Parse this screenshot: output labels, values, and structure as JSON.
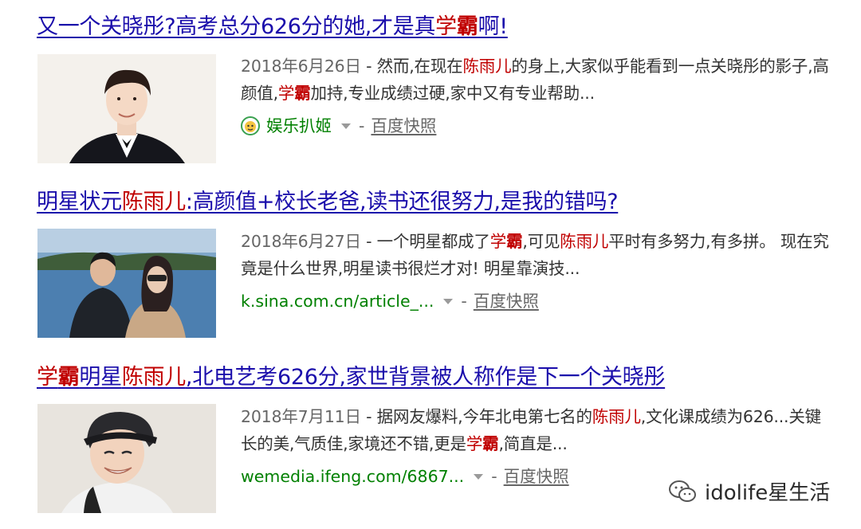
{
  "results": [
    {
      "title_parts": [
        {
          "text": "又一个关晓彤?高考总分626分的她,才是真",
          "style": "normal"
        },
        {
          "text": "学",
          "style": "hl"
        },
        {
          "text": "霸",
          "style": "hl-strong"
        },
        {
          "text": "啊!",
          "style": "normal"
        }
      ],
      "date": "2018年6月26日",
      "abstract_parts": [
        {
          "text": " - 然而,在现在",
          "style": "normal"
        },
        {
          "text": "陈雨儿",
          "style": "hl"
        },
        {
          "text": "的身上,大家似乎能看到一点关晓彤的影子,高颜值,",
          "style": "normal"
        },
        {
          "text": "学",
          "style": "hl"
        },
        {
          "text": "霸",
          "style": "hl-strong"
        },
        {
          "text": "加持,专业成绩过硬,家中又有专业帮助...",
          "style": "normal"
        }
      ],
      "source": "娱乐扒姬",
      "separator": "-",
      "snapshot": "百度快照"
    },
    {
      "title_parts": [
        {
          "text": "明星状元",
          "style": "normal"
        },
        {
          "text": "陈雨儿",
          "style": "hl"
        },
        {
          "text": ":高颜值+校长老爸,读书还很努力,是我的错吗?",
          "style": "normal"
        }
      ],
      "date": "2018年6月27日",
      "abstract_parts": [
        {
          "text": " - 一个明星都成了",
          "style": "normal"
        },
        {
          "text": "学",
          "style": "hl"
        },
        {
          "text": "霸",
          "style": "hl-strong"
        },
        {
          "text": ",可见",
          "style": "normal"
        },
        {
          "text": "陈雨儿",
          "style": "hl"
        },
        {
          "text": "平时有多努力,有多拼。 现在究竟是什么世界,明星读书很烂才对! 明星靠演技...",
          "style": "normal"
        }
      ],
      "url": "k.sina.com.cn/article_...",
      "separator": "-",
      "snapshot": "百度快照"
    },
    {
      "title_parts": [
        {
          "text": "学",
          "style": "hl"
        },
        {
          "text": "霸",
          "style": "hl-strong"
        },
        {
          "text": "明星",
          "style": "normal"
        },
        {
          "text": "陈雨儿",
          "style": "hl"
        },
        {
          "text": ",北电艺考626分,家世背景被人称作是下一个关晓彤",
          "style": "normal"
        }
      ],
      "date": "2018年7月11日",
      "abstract_parts": [
        {
          "text": " - 据网友爆料,今年北电第七名的",
          "style": "normal"
        },
        {
          "text": "陈雨儿",
          "style": "hl"
        },
        {
          "text": ",文化课成绩为626...关键长的美,气质佳,家境还不错,更是",
          "style": "normal"
        },
        {
          "text": "学",
          "style": "hl"
        },
        {
          "text": "霸",
          "style": "hl-strong"
        },
        {
          "text": ",简直是...",
          "style": "normal"
        }
      ],
      "url": "wemedia.ifeng.com/6867...",
      "separator": "-",
      "snapshot": "百度快照"
    }
  ],
  "watermark": "idolife星生活",
  "icons": {
    "source_icon": "face-avatar-icon",
    "dropdown": "chevron-down-icon",
    "watermark": "wechat-icon"
  },
  "colors": {
    "title_link": "#1a0dab",
    "highlight": "#c00000",
    "url_green": "#008000",
    "meta_gray": "#666666"
  }
}
